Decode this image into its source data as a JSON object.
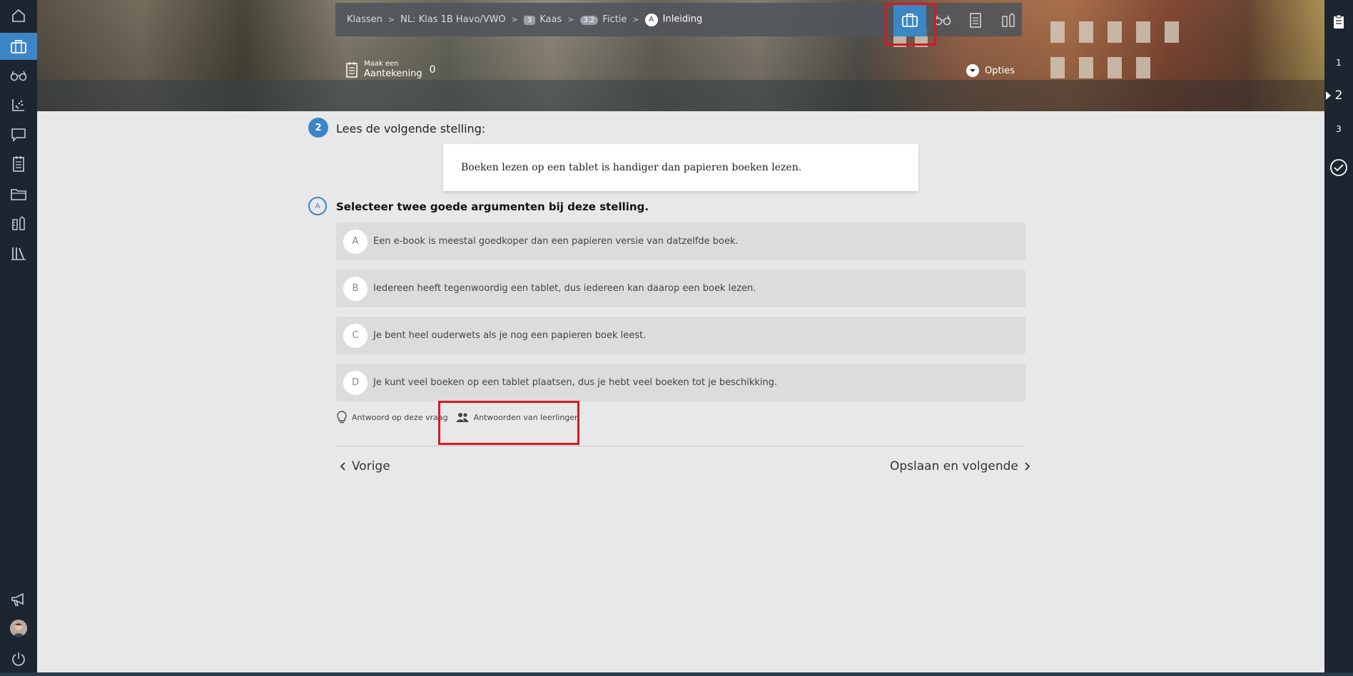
{
  "breadcrumb": {
    "items": [
      {
        "label": "Klassen"
      },
      {
        "label": "NL: Klas 1B Havo/VWO"
      },
      {
        "badge": "3",
        "label": "Kaas"
      },
      {
        "badge": "3.2",
        "label": "Fictie"
      },
      {
        "badge": "A",
        "label": "Inleiding"
      }
    ]
  },
  "header": {
    "note_line1": "Maak een",
    "note_line2": "Aantekening",
    "note_count": "0",
    "options_label": "Opties"
  },
  "right_nav": {
    "items": [
      "1",
      "2",
      "3"
    ],
    "current": "2"
  },
  "question": {
    "number": "2",
    "title": "Lees de volgende stelling:",
    "statement": "Boeken lezen op een tablet is handiger dan papieren boeken lezen.",
    "sub_letter": "A",
    "sub_title": "Selecteer twee goede argumenten bij deze stelling.",
    "options": [
      {
        "letter": "A",
        "text": "Een e-book is meestal goedkoper dan een papieren versie van datzelfde boek."
      },
      {
        "letter": "B",
        "text": "Iedereen heeft tegenwoordig een tablet, dus iedereen kan daarop een boek lezen."
      },
      {
        "letter": "C",
        "text": "Je bent heel ouderwets als je nog een papieren boek leest."
      },
      {
        "letter": "D",
        "text": "Je kunt veel boeken op een tablet plaatsen, dus je hebt veel boeken tot je beschikking."
      }
    ],
    "answer_link": "Antwoord op deze vraag",
    "student_answers_link": "Antwoorden van leerlingen"
  },
  "nav": {
    "prev": "Vorige",
    "next": "Opslaan en volgende"
  },
  "colors": {
    "accent": "#3d86c6",
    "sidebar": "#1d2530",
    "highlight": "#d71920"
  },
  "icons": {
    "left_sidebar": [
      "home-icon",
      "briefcase-icon",
      "glasses-icon",
      "chart-icon",
      "chat-icon",
      "notes-icon",
      "folder-icon",
      "tools-icon",
      "library-icon",
      "megaphone-icon",
      "avatar",
      "power-icon"
    ],
    "modes": [
      "briefcase-icon",
      "glasses-icon",
      "notes-icon",
      "tools-icon"
    ]
  }
}
